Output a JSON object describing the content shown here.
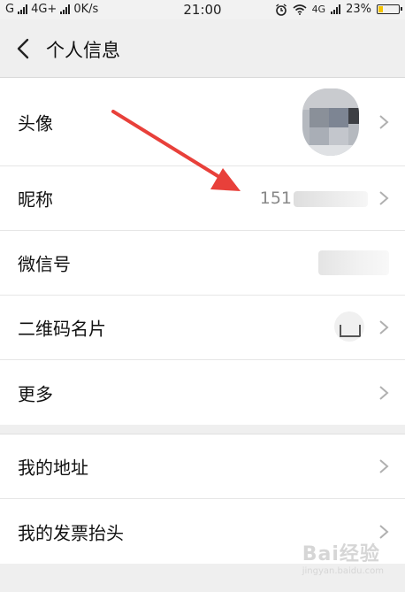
{
  "status_bar": {
    "carrier1": "G",
    "carrier2": "4G+",
    "speed": "0K/s",
    "time": "21:00",
    "network": "4G",
    "battery": "23%",
    "battery_level": 0.23,
    "icons": [
      "signal-icon",
      "alarm-icon",
      "wifi-icon",
      "battery-icon"
    ]
  },
  "nav": {
    "title": "个人信息",
    "back_icon": "chevron-left-icon"
  },
  "profile_items": [
    {
      "label": "头像",
      "value_type": "avatar"
    },
    {
      "label": "昵称",
      "value": "151"
    },
    {
      "label": "微信号",
      "value_type": "redacted"
    },
    {
      "label": "二维码名片",
      "value_type": "qr-thumbnail"
    },
    {
      "label": "更多"
    }
  ],
  "extra_items": [
    {
      "label": "我的地址"
    },
    {
      "label": "我的发票抬头"
    }
  ],
  "annotation": {
    "color": "#e8403a"
  },
  "watermark": {
    "text": "Bai经验",
    "subtext": "jingyan.baidu.com"
  },
  "colors": {
    "background": "#efefef",
    "accent_arrow": "#e8403a",
    "battery_fill": "#f5c400"
  }
}
